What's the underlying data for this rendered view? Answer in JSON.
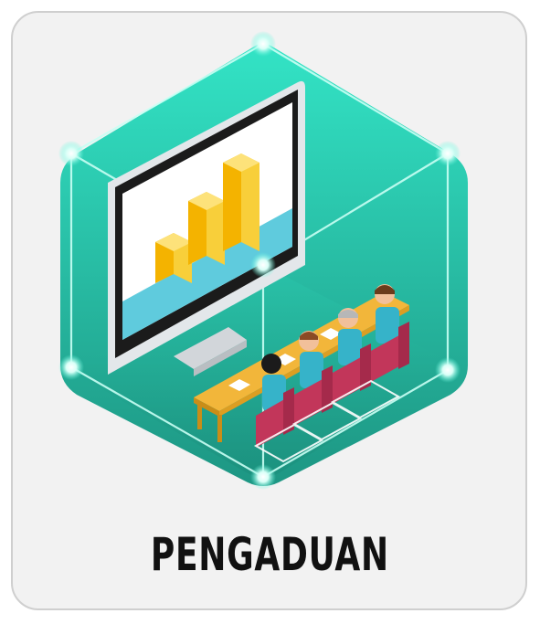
{
  "card": {
    "label": "PENGADUAN"
  },
  "illustration": {
    "icon": "meeting-presentation-icon",
    "colors": {
      "hex_top": "#2fe0c1",
      "hex_bottom": "#1f9a86",
      "glow": "#b8fff0",
      "chart_bars": "#f6c21c",
      "chair": "#c2365a",
      "table": "#f2b63a",
      "shirt": "#36b3c9"
    }
  }
}
